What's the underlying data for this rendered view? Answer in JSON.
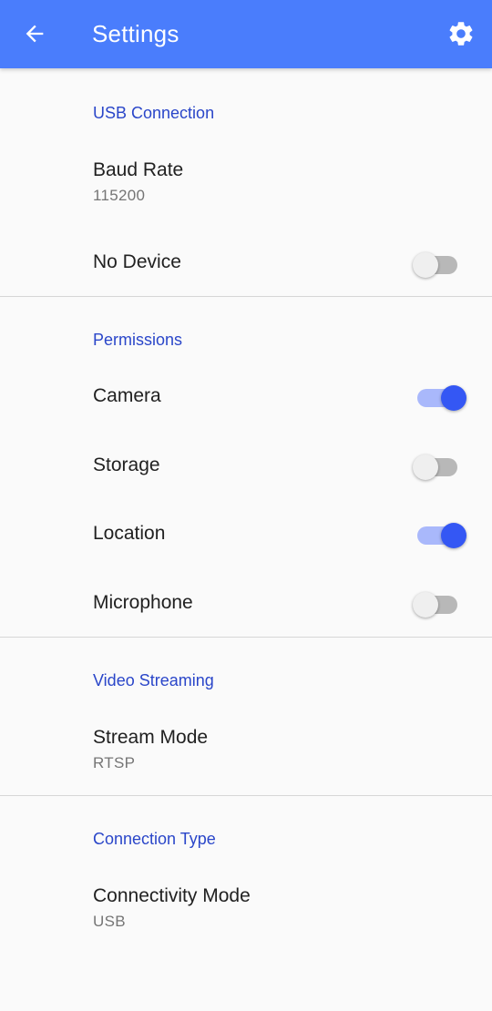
{
  "appbar": {
    "title": "Settings",
    "back_icon": "arrow-back-icon",
    "settings_icon": "gear-icon",
    "background": "#4a7dfc"
  },
  "accent_color": "#2a46c9",
  "switch_on_color": "#3457f4",
  "sections": {
    "usb": {
      "header": "USB Connection",
      "baud_rate": {
        "title": "Baud Rate",
        "value": "115200"
      },
      "no_device": {
        "title": "No Device",
        "enabled": false
      }
    },
    "permissions": {
      "header": "Permissions",
      "camera": {
        "title": "Camera",
        "enabled": true
      },
      "storage": {
        "title": "Storage",
        "enabled": false
      },
      "location": {
        "title": "Location",
        "enabled": true
      },
      "microphone": {
        "title": "Microphone",
        "enabled": false
      }
    },
    "video": {
      "header": "Video Streaming",
      "stream_mode": {
        "title": "Stream Mode",
        "value": "RTSP"
      }
    },
    "connection": {
      "header": "Connection Type",
      "connectivity_mode": {
        "title": "Connectivity Mode",
        "value": "USB"
      }
    }
  }
}
